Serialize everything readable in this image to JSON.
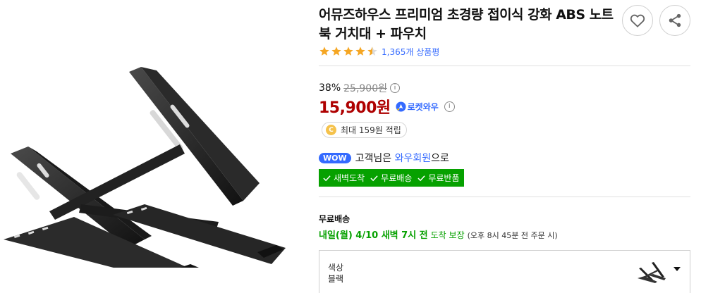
{
  "product": {
    "title": "어뮤즈하우스 프리미엄 초경량 접이식 강화 ABS 노트북 거치대 + 파우치",
    "rating": 4.5,
    "review_count_text": "1,365개 상품평"
  },
  "price": {
    "discount_rate": "38%",
    "original_price": "25,900원",
    "sale_price": "15,900원",
    "rocket_badge": "로켓와우",
    "info_mark": "i"
  },
  "point": {
    "coin_mark": "C",
    "text": "최대 159원 적립"
  },
  "wow": {
    "badge": "WOW",
    "prefix": "고객님은 ",
    "link": "와우회원",
    "suffix": "으로"
  },
  "benefits": [
    "새벽도착",
    "무료배송",
    "무료반품"
  ],
  "shipping": {
    "label": "무료배송",
    "arrival": "내일(월) 4/10 새벽 7시 전",
    "guarantee": "도착 보장",
    "note": "(오후 8시 45분 전 주문 시)"
  },
  "option": {
    "label": "색상",
    "value": "블랙"
  },
  "colors": {
    "sale": "#ae0000",
    "accent": "#346aff",
    "benefit_bg": "#06a100",
    "star": "#f5a623"
  },
  "icons": {
    "heart": "heart-icon",
    "share": "share-icon",
    "check": "check-icon",
    "caret": "caret-down-icon"
  }
}
